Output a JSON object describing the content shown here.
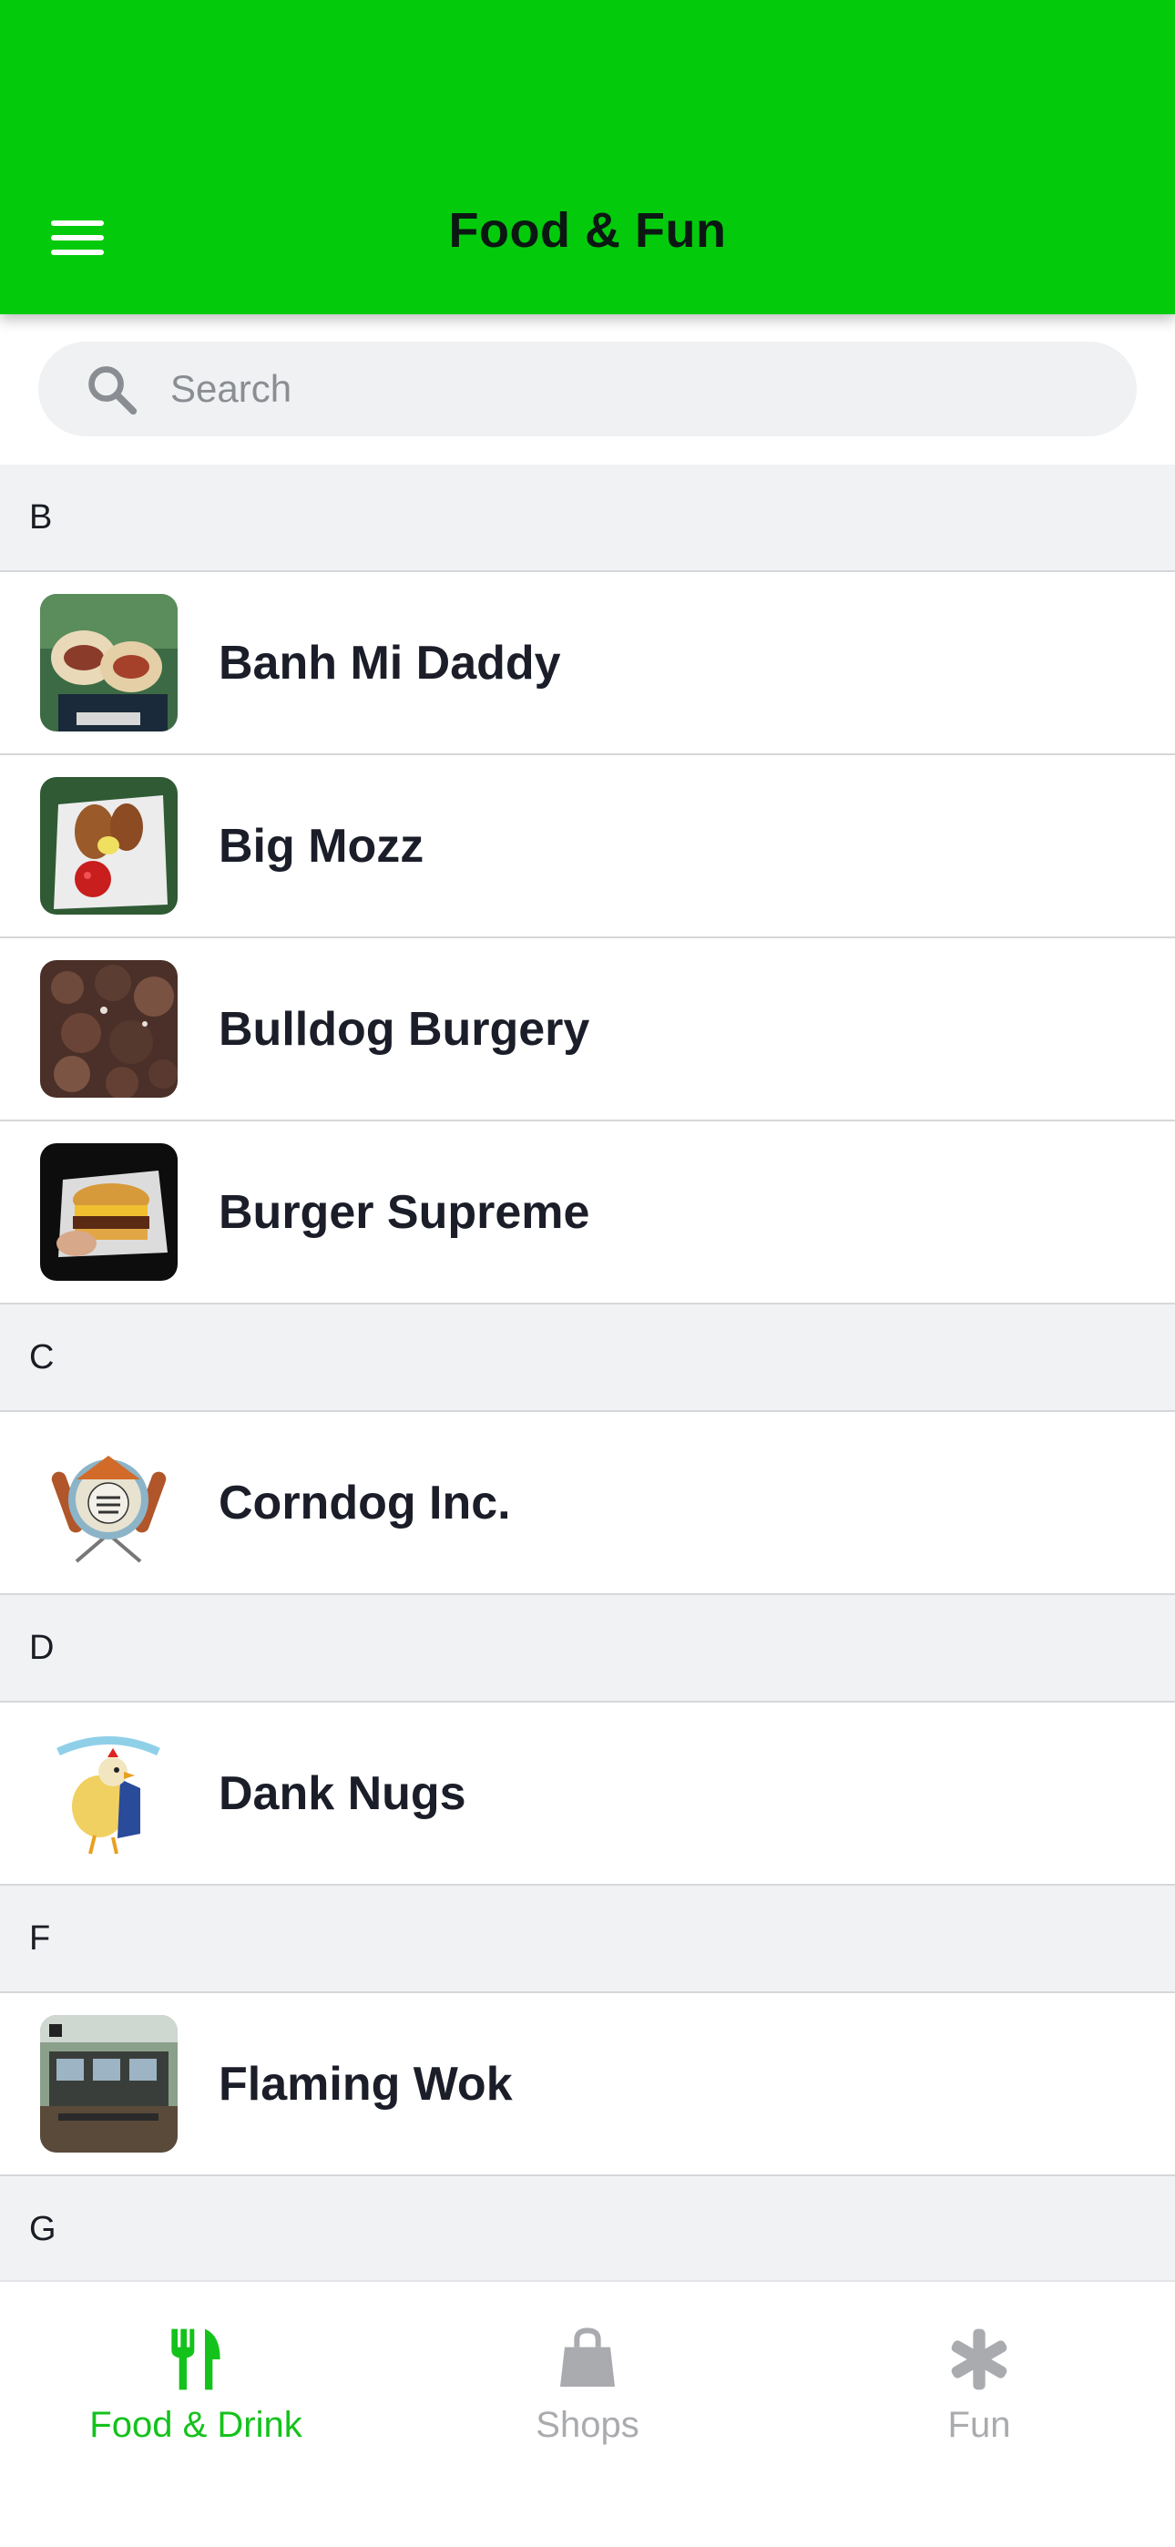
{
  "header": {
    "title": "Food & Fun",
    "menu_icon": "hamburger-menu-icon",
    "background": "#03cb0c"
  },
  "search": {
    "placeholder": "Search",
    "value": "",
    "icon": "search-icon"
  },
  "sections": [
    {
      "letter": "B",
      "items": [
        {
          "name": "Banh Mi Daddy"
        },
        {
          "name": "Big Mozz"
        },
        {
          "name": "Bulldog Burgery"
        },
        {
          "name": "Burger Supreme"
        }
      ]
    },
    {
      "letter": "C",
      "items": [
        {
          "name": "Corndog Inc."
        }
      ]
    },
    {
      "letter": "D",
      "items": [
        {
          "name": "Dank Nugs"
        }
      ]
    },
    {
      "letter": "F",
      "items": [
        {
          "name": "Flaming Wok"
        }
      ]
    },
    {
      "letter": "G",
      "items": []
    }
  ],
  "tabbar": {
    "tabs": [
      {
        "label": "Food & Drink",
        "icon": "fork-knife-icon",
        "active": true
      },
      {
        "label": "Shops",
        "icon": "shopping-bag-icon",
        "active": false
      },
      {
        "label": "Fun",
        "icon": "asterisk-icon",
        "active": false
      }
    ],
    "active_color": "#14c21c",
    "inactive_color": "#a9abae"
  }
}
